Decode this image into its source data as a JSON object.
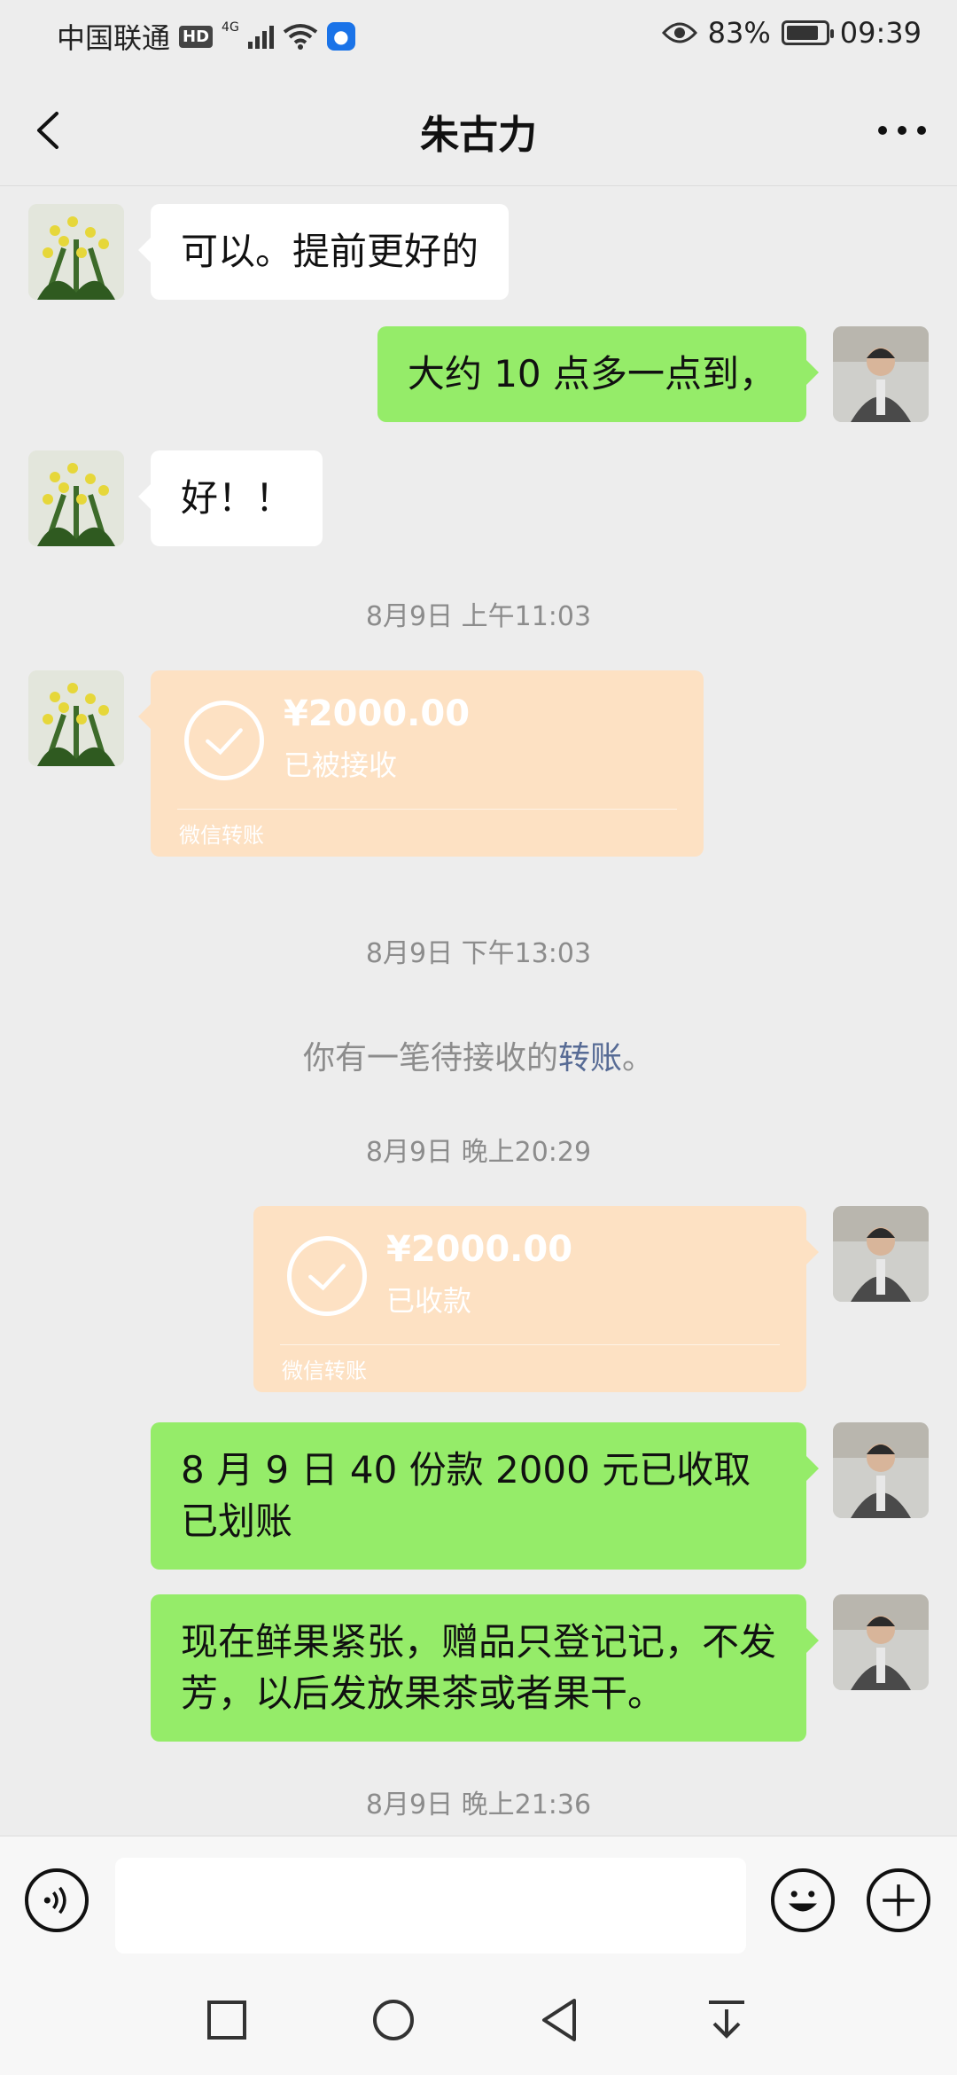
{
  "status_bar": {
    "carrier": "中国联通",
    "hd_badge": "HD",
    "network": "4G",
    "battery_percent": "83%",
    "battery_level": 0.83,
    "time": "09:39",
    "icons": [
      "eye-icon",
      "wifi-icon",
      "signal-icon",
      "bulb-icon",
      "battery-icon"
    ]
  },
  "header": {
    "title": "朱古力",
    "back_icon": "back-chevron-icon",
    "more_icon": "more-dots-icon"
  },
  "messages": [
    {
      "type": "text",
      "direction": "in",
      "text": "可以。提前更好的"
    },
    {
      "type": "text",
      "direction": "out",
      "text": "大约 10 点多一点到，"
    },
    {
      "type": "text",
      "direction": "in",
      "text": "好！！"
    },
    {
      "type": "timestamp",
      "text": "8月9日 上午11:03"
    },
    {
      "type": "transfer",
      "direction": "in",
      "amount": "¥2000.00",
      "status": "已被接收",
      "label": "微信转账"
    },
    {
      "type": "timestamp",
      "text": "8月9日 下午13:03"
    },
    {
      "type": "system",
      "text": "你有一笔待接收的",
      "link": "转账",
      "suffix": "。"
    },
    {
      "type": "timestamp",
      "text": "8月9日 晚上20:29"
    },
    {
      "type": "transfer",
      "direction": "out",
      "amount": "¥2000.00",
      "status": "已收款",
      "label": "微信转账"
    },
    {
      "type": "text",
      "direction": "out",
      "text": "8 月 9 日 40 份款 2000 元已收取已划账"
    },
    {
      "type": "text",
      "direction": "out",
      "text": "现在鲜果紧张，赠品只登记记，不发芳，以后发放果茶或者果干。"
    },
    {
      "type": "timestamp",
      "text": "8月9日 晚上21:36"
    }
  ],
  "input_bar": {
    "placeholder": "",
    "icons": [
      "voice-icon",
      "emoji-icon",
      "plus-icon"
    ]
  },
  "nav_bar": {
    "icons": [
      "recent-apps-icon",
      "home-icon",
      "back-icon",
      "notification-pull-icon"
    ]
  },
  "colors": {
    "background": "#ededed",
    "outgoing_bubble": "#95ec69",
    "incoming_bubble": "#ffffff",
    "transfer_card": "#fde1c3",
    "link": "#576b95",
    "timestamp": "#8c8c8c"
  }
}
